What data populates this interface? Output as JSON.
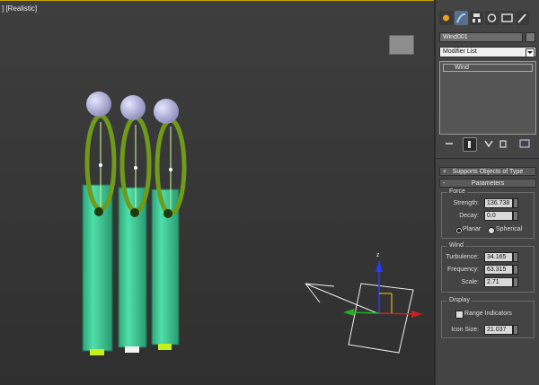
{
  "viewport": {
    "label": "] [Realistic]",
    "viewcube_label": "",
    "gizmo": {
      "axis_z": "z",
      "axis_x": "x",
      "axis_y": "y"
    }
  },
  "panel": {
    "tabs": [
      "create-icon",
      "modify-icon",
      "hierarchy-icon",
      "motion-icon",
      "display-icon",
      "utilities-icon"
    ],
    "object_name": "Wind001",
    "modifier_list": "Modifier List",
    "stack_item": "Wind",
    "rollouts": {
      "supports": "Supports Objects of Type",
      "parameters": "Parameters"
    },
    "force": {
      "title": "Force",
      "strength_label": "Strength:",
      "strength": "136.738",
      "decay_label": "Decay:",
      "decay": "0.0",
      "planar": "Planar",
      "spherical": "Spherical",
      "planar_selected": true
    },
    "wind": {
      "title": "Wind",
      "turbulence_label": "Turbulence:",
      "turbulence": "34.165",
      "frequency_label": "Frequency:",
      "frequency": "63.315",
      "scale_label": "Scale:",
      "scale": "2.71"
    },
    "display": {
      "title": "Display",
      "range_indicators": "Range Indicators",
      "range_checked": false,
      "icon_size_label": "Icon Size:",
      "icon_size": "21.037"
    },
    "colors": {
      "accent": "#c9a300",
      "cylinder": "#3fcf98",
      "ring": "#6f9a1a",
      "sphere": "#bdbde8"
    }
  }
}
